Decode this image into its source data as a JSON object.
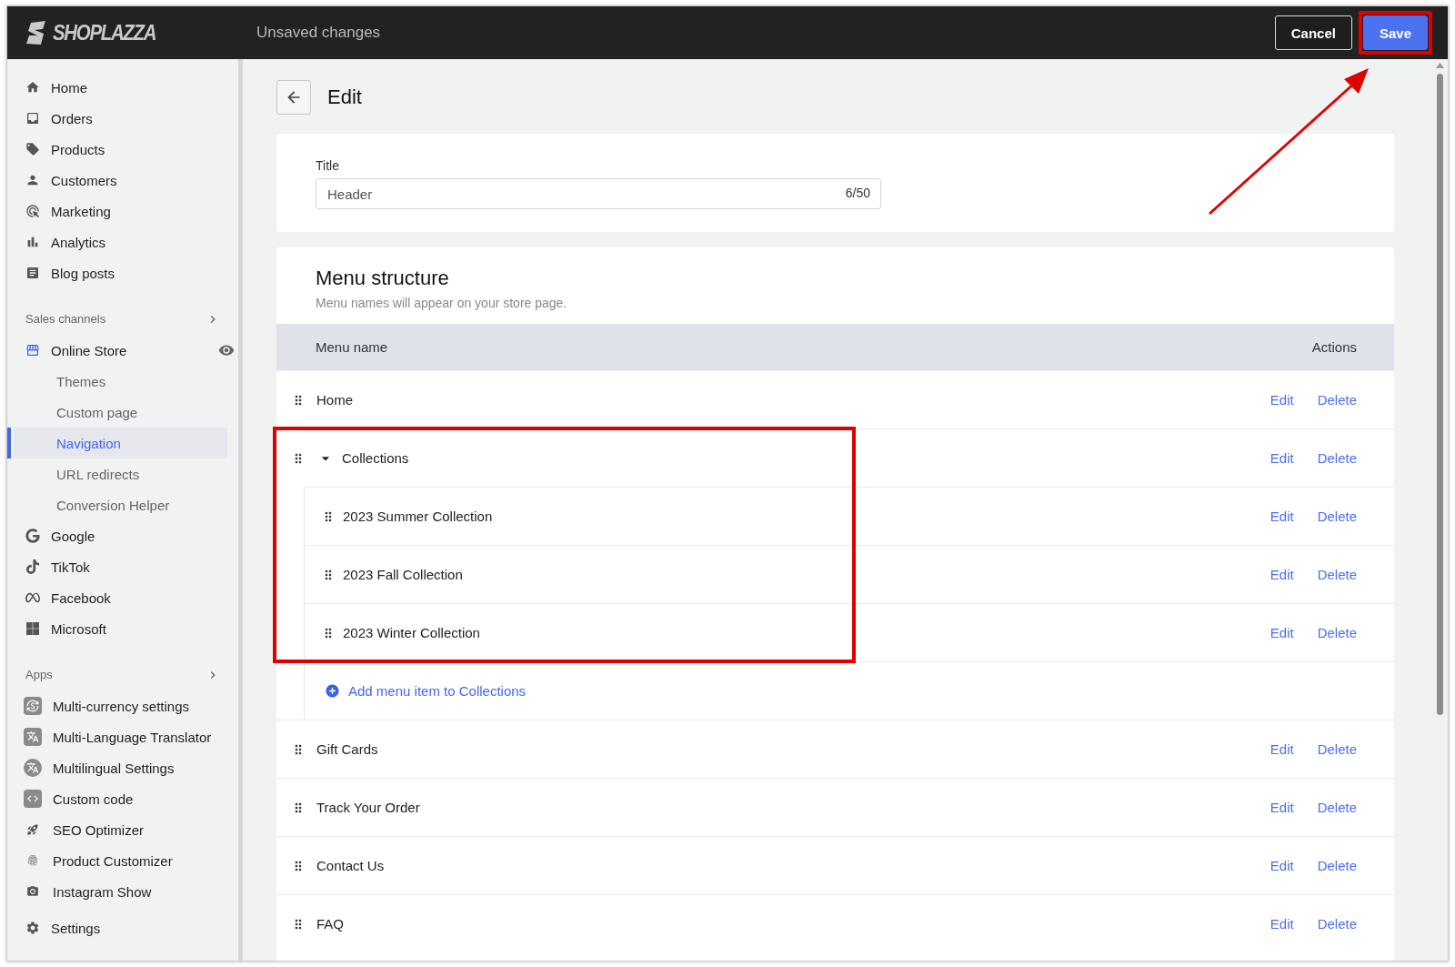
{
  "top_bar": {
    "logo": "SHOPLAZZA",
    "status": "Unsaved changes",
    "buttons": [
      {
        "label": "Cancel",
        "kind": "secondary",
        "highlighted": false
      },
      {
        "label": "Save",
        "kind": "primary",
        "highlighted": true
      }
    ]
  },
  "sidebar": {
    "items": [
      {
        "label": "Home",
        "selected": false
      },
      {
        "label": "Orders",
        "selected": false
      },
      {
        "label": "Products",
        "selected": false
      },
      {
        "label": "Customers",
        "selected": false
      },
      {
        "label": "Marketing",
        "selected": false
      },
      {
        "label": "Analytics",
        "selected": false
      },
      {
        "label": "Blog posts",
        "selected": false
      }
    ],
    "sections": [
      {
        "title": "Sales channels",
        "items": [
          {
            "label": "Online Store",
            "selected": false,
            "expanded": true,
            "children": [
              {
                "label": "Themes",
                "selected": false
              },
              {
                "label": "Custom page",
                "selected": false
              },
              {
                "label": "Navigation",
                "selected": true
              },
              {
                "label": "URL redirects",
                "selected": false
              },
              {
                "label": "Conversion Helper",
                "selected": false
              }
            ]
          },
          {
            "label": "Google",
            "selected": false
          },
          {
            "label": "TikTok",
            "selected": false
          },
          {
            "label": "Facebook",
            "selected": false
          },
          {
            "label": "Microsoft",
            "selected": false
          }
        ]
      },
      {
        "title": "Apps",
        "items": [
          {
            "label": "Multi-currency settings",
            "selected": false
          },
          {
            "label": "Multi-Language Translator",
            "selected": false
          },
          {
            "label": "Multilingual Settings",
            "selected": false
          },
          {
            "label": "Custom code",
            "selected": false
          },
          {
            "label": "SEO Optimizer",
            "selected": false
          },
          {
            "label": "Product Customizer",
            "selected": false
          },
          {
            "label": "Instagram Show",
            "selected": false
          }
        ]
      }
    ],
    "footer_item": {
      "label": "Settings",
      "selected": false
    }
  },
  "page": {
    "title": "Edit",
    "title_card": {
      "label": "Title",
      "value": "Header",
      "counter": "6/50"
    },
    "menu": {
      "heading": "Menu structure",
      "description": "Menu names will appear on your store page.",
      "columns": [
        "Menu name",
        "Actions"
      ],
      "items": [
        {
          "label": "Home",
          "actions": [
            "Edit",
            "Delete"
          ]
        },
        {
          "label": "Collections",
          "actions": [
            "Edit",
            "Delete"
          ],
          "expanded": true,
          "highlighted": true,
          "add_link": "Add menu item to Collections",
          "children": [
            {
              "label": "2023 Summer Collection",
              "actions": [
                "Edit",
                "Delete"
              ]
            },
            {
              "label": "2023 Fall Collection",
              "actions": [
                "Edit",
                "Delete"
              ]
            },
            {
              "label": "2023 Winter Collection",
              "actions": [
                "Edit",
                "Delete"
              ]
            }
          ]
        },
        {
          "label": "Gift Cards",
          "actions": [
            "Edit",
            "Delete"
          ]
        },
        {
          "label": "Track Your Order",
          "actions": [
            "Edit",
            "Delete"
          ]
        },
        {
          "label": "Contact Us",
          "actions": [
            "Edit",
            "Delete"
          ]
        },
        {
          "label": "FAQ",
          "actions": [
            "Edit",
            "Delete"
          ]
        }
      ]
    }
  }
}
